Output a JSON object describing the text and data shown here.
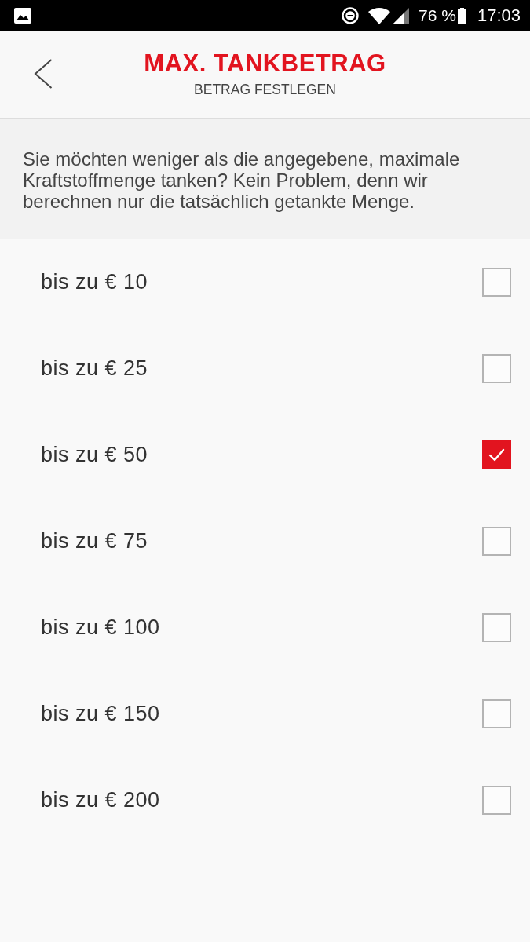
{
  "status_bar": {
    "battery": "76 %",
    "time": "17:03"
  },
  "header": {
    "title": "MAX. TANKBETRAG",
    "subtitle": "BETRAG FESTLEGEN"
  },
  "intro": {
    "text": "Sie möchten weniger als die angegebene, maximale Kraftstoffmenge tanken? Kein Problem, denn wir berechnen nur die tatsächlich getankte Menge."
  },
  "options": [
    {
      "label": "bis zu € 10",
      "selected": false
    },
    {
      "label": "bis zu € 25",
      "selected": false
    },
    {
      "label": "bis zu € 50",
      "selected": true
    },
    {
      "label": "bis zu € 75",
      "selected": false
    },
    {
      "label": "bis zu € 100",
      "selected": false
    },
    {
      "label": "bis zu € 150",
      "selected": false
    },
    {
      "label": "bis zu € 200",
      "selected": false
    }
  ]
}
